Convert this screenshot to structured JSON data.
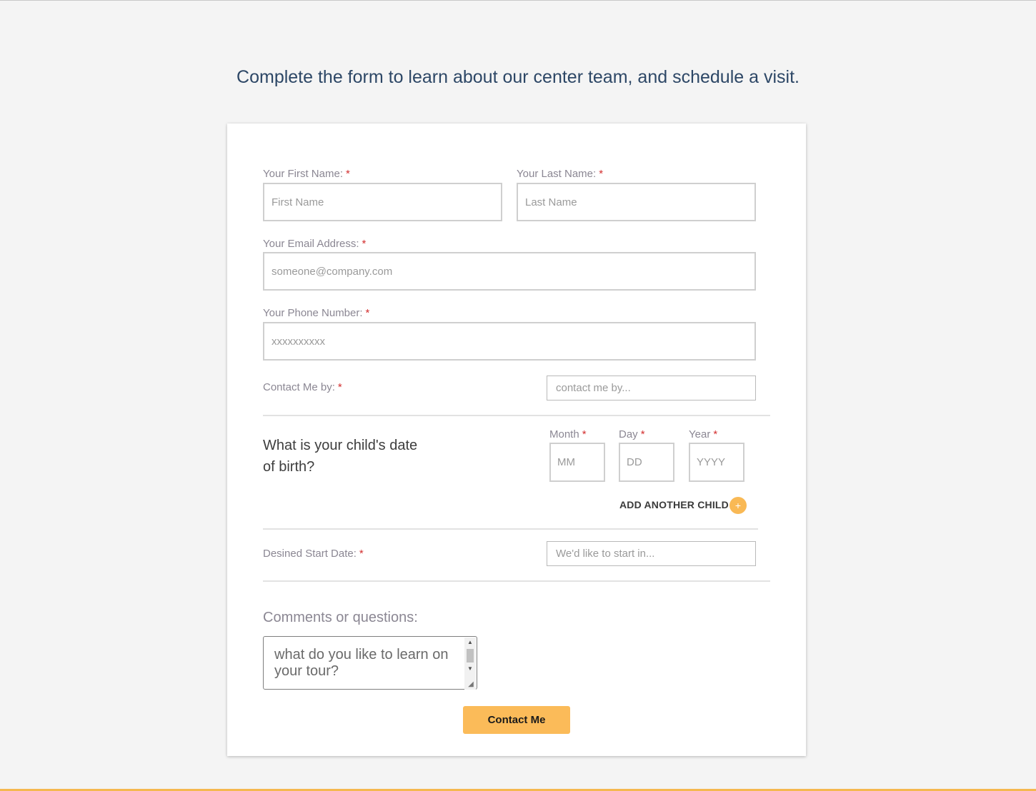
{
  "headline": "Complete the form to learn about our center team, and schedule a visit.",
  "form": {
    "first_name": {
      "label": "Your First Name:",
      "required": "*",
      "placeholder": "First Name"
    },
    "last_name": {
      "label": "Your Last Name:",
      "required": "*",
      "placeholder": "Last Name"
    },
    "email": {
      "label": "Your Email Address:",
      "required": "*",
      "placeholder": "someone@company.com"
    },
    "phone": {
      "label": "Your Phone Number:",
      "required": "*",
      "placeholder": "xxxxxxxxxx"
    },
    "contact_by": {
      "label": "Contact Me by:",
      "required": "*",
      "placeholder": "contact me by..."
    },
    "dob": {
      "question": "What is your child's date of birth?",
      "month": {
        "label": "Month",
        "required": "*",
        "placeholder": "MM"
      },
      "day": {
        "label": "Day",
        "required": "*",
        "placeholder": "DD"
      },
      "year": {
        "label": "Year",
        "required": "*",
        "placeholder": "YYYY"
      },
      "add_child_label": "ADD ANOTHER CHILD",
      "add_child_icon": "+"
    },
    "start_date": {
      "label": "Desined Start Date:",
      "required": "*",
      "placeholder": "We'd like to start in..."
    },
    "comments": {
      "label": "Comments or questions:",
      "placeholder": "what do you like to learn on your tour?"
    },
    "submit_label": "Contact Me"
  },
  "colors": {
    "accent": "#fbbb59",
    "headline": "#2d4766",
    "required": "#d32f2f",
    "label": "#8b8793"
  }
}
